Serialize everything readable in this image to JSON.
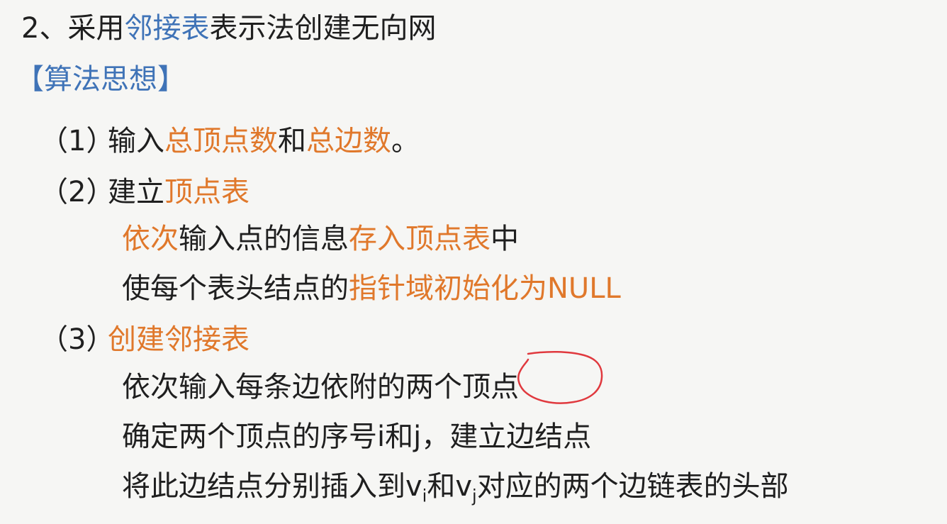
{
  "title": {
    "prefix": "2、采用",
    "highlight": "邻接表",
    "suffix": "表示法创建无向网"
  },
  "heading": "【算法思想】",
  "steps": {
    "1": {
      "number": "（1）",
      "text_a": "输入",
      "highlight_a": "总顶点数",
      "text_b": "和",
      "highlight_b": "总边数",
      "text_c": "。"
    },
    "2": {
      "number": "（2）",
      "text_a": "建立",
      "highlight_a": "顶点表",
      "sub_1": {
        "highlight_a": "依次",
        "text_a": "输入点的信息",
        "highlight_b": "存入顶点表",
        "text_b": "中"
      },
      "sub_2": {
        "text_a": "使每个表头结点的",
        "highlight_a": "指针域初始化为NULL"
      }
    },
    "3": {
      "number": "（3）",
      "highlight_a": "创建邻接表",
      "sub_1": {
        "text_a": "依次输入每条边依附的两个",
        "text_b": "顶点"
      },
      "sub_2": {
        "text_a": "确定两个顶点的序号i和j，建立边结点"
      },
      "sub_3": {
        "text_a": "将此边结点分别插入到v",
        "sub_i": "i",
        "text_b": "和v",
        "sub_j": "j",
        "text_c": "对应的两个边链表的头部"
      }
    }
  },
  "colors": {
    "blue": "#3f73b7",
    "orange": "#e0782b",
    "ink": "#1f1f1f",
    "annotation": "#e0393e",
    "background": "#f6f6f4"
  }
}
